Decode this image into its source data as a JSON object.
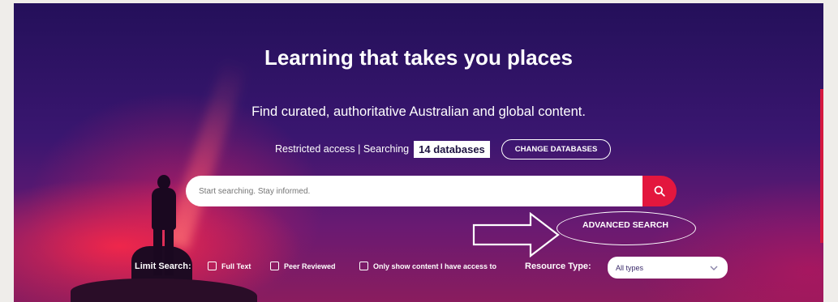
{
  "hero": {
    "title": "Learning that takes you places",
    "subtitle": "Find curated, authoritative Australian and global content."
  },
  "access": {
    "status": "Restricted access | Searching",
    "databases": "14 databases",
    "change_button": "CHANGE DATABASES"
  },
  "search": {
    "placeholder": "Start searching. Stay informed.",
    "button_icon": "search-icon"
  },
  "advanced_search": {
    "label": "ADVANCED SEARCH"
  },
  "limit": {
    "label": "Limit Search:",
    "options": [
      "Full Text",
      "Peer Reviewed",
      "Only show content I have access to"
    ]
  },
  "resource_type": {
    "label": "Resource Type:",
    "selected": "All types"
  },
  "colors": {
    "accent": "#e3173e",
    "navy": "#24105a"
  }
}
